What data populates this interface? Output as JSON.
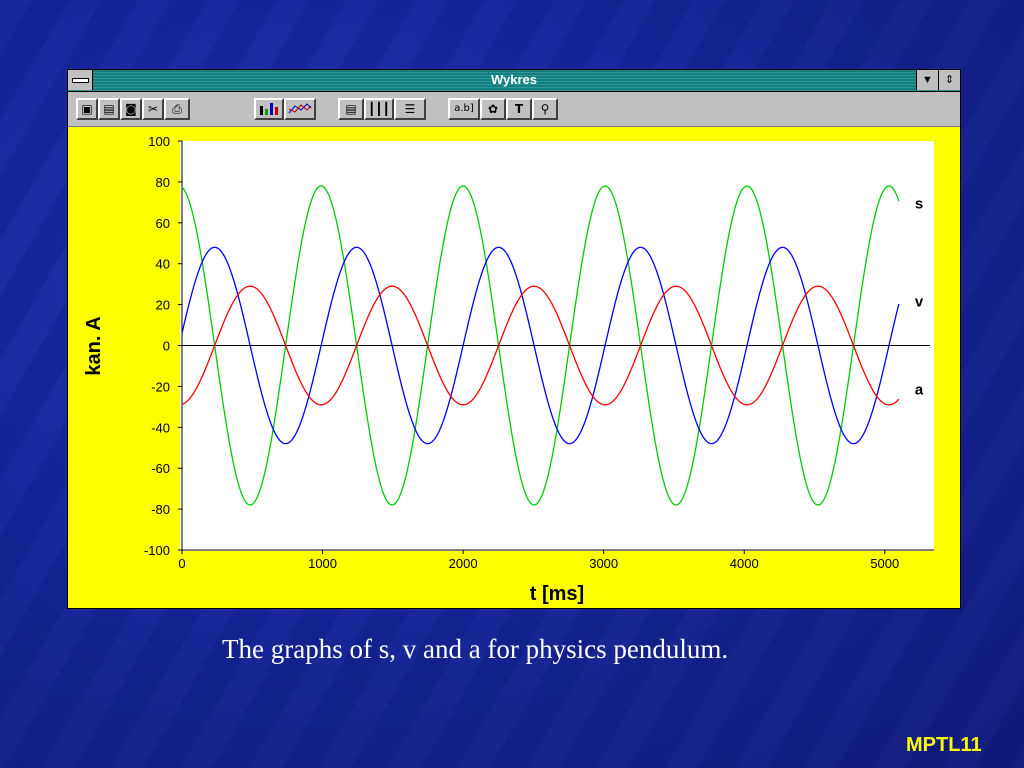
{
  "window": {
    "title": "Wykres",
    "toolbar_icons": [
      "save-icon",
      "save-as-icon",
      "camera-icon",
      "cut-icon",
      "print-icon",
      "bar-chart-icon",
      "line-chart-icon",
      "document-icon",
      "columns-icon",
      "rows-icon",
      "label-icon",
      "palette-icon",
      "text-tool-icon",
      "zoom-icon"
    ]
  },
  "chart_data": {
    "type": "line",
    "xlabel": "t [ms]",
    "ylabel": "kan. A",
    "xlim": [
      0,
      5350
    ],
    "ylim": [
      -100,
      100
    ],
    "xticks": [
      0,
      1000,
      2000,
      3000,
      4000,
      5000
    ],
    "yticks": [
      100,
      80,
      60,
      40,
      20,
      0,
      -20,
      -40,
      -60,
      -80,
      -100
    ],
    "zero_line": true,
    "series": [
      {
        "name": "s",
        "color": "#00cc00",
        "period": 1010,
        "amplitude": 78,
        "phase": 0.27,
        "x_start": 0,
        "x_end": 5100
      },
      {
        "name": "v",
        "color": "#0000ff",
        "period": 1010,
        "amplitude": 48,
        "phase": 0.02,
        "x_start": 0,
        "x_end": 5100
      },
      {
        "name": "a",
        "color": "#ff0000",
        "period": 1010,
        "amplitude": 29,
        "phase": -0.23,
        "x_start": 0,
        "x_end": 5100
      }
    ]
  },
  "caption": "The graphs of s, v and a for physics pendulum.",
  "logo": "MPTL11"
}
